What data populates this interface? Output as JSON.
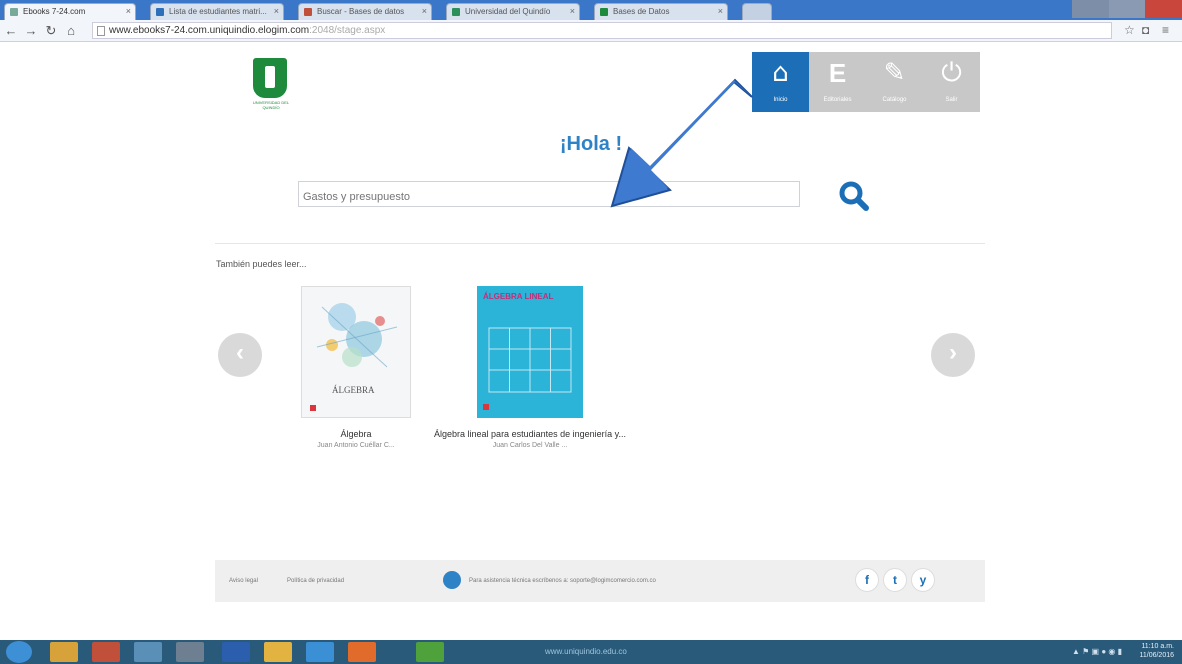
{
  "browser": {
    "tabs": [
      {
        "label": "Ebooks 7-24.com"
      },
      {
        "label": "Lista de estudiantes matri..."
      },
      {
        "label": "Buscar - Bases de datos"
      },
      {
        "label": "Universidad del Quindío"
      },
      {
        "label": "Bases de Datos"
      },
      {
        "label": ""
      }
    ],
    "address_host": "www.ebooks7-24.com.uniquindio.elogim.com",
    "address_path": ":2048/stage.aspx"
  },
  "header": {
    "logo_text": "UNIVERSIDAD DEL QUINDÍO",
    "nav": [
      {
        "label": "Inicio",
        "icon": "home-icon",
        "glyph": "⌂"
      },
      {
        "label": "Editoriales",
        "icon": "editorials-icon",
        "glyph": "E"
      },
      {
        "label": "Catálogo",
        "icon": "catalog-icon",
        "glyph": "✎"
      },
      {
        "label": "Salir",
        "icon": "power-icon",
        "glyph": "⏻"
      }
    ]
  },
  "main": {
    "greeting": "¡Hola !",
    "search_placeholder": "Gastos y presupuesto",
    "also_read": "También puedes leer...",
    "books": [
      {
        "title": "Álgebra",
        "author": "Juan Antonio Cuéllar C...",
        "cover_word": "ÁLGEBRA"
      },
      {
        "title": "Álgebra lineal para estudiantes de ingeniería y...",
        "author": "Juan Carlos Del Valle ...",
        "cover_word": "ÁLGEBRA LINEAL"
      }
    ]
  },
  "footer": {
    "legal": "Aviso legal",
    "privacy": "Política de privacidad",
    "support": "Para asistencia técnica escríbenos a: soporte@logimcomercio.com.co",
    "social": [
      "f",
      "t",
      "y"
    ]
  },
  "taskbar": {
    "center_text": "www.uniquindio.edu.co",
    "time": "11:10 a.m.",
    "date": "11/06/2016"
  },
  "colors": {
    "accent": "#1c6fb6",
    "greeting": "#2e82c6",
    "annotation_arrow": "#3e7ad0",
    "logo_green": "#1e8a3c"
  }
}
